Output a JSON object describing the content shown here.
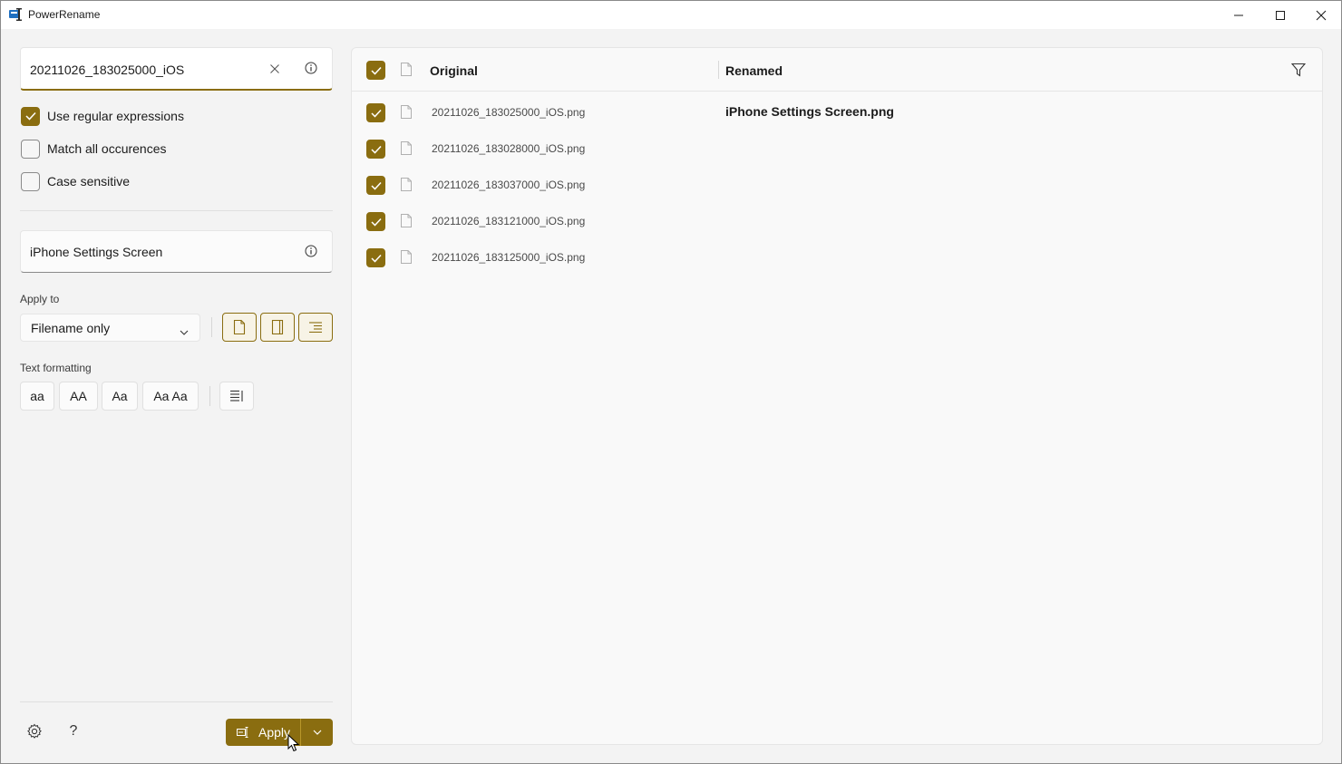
{
  "window": {
    "title": "PowerRename"
  },
  "search": {
    "value": "20211026_183025000_iOS"
  },
  "options": {
    "use_regex": {
      "label": "Use regular expressions",
      "checked": true
    },
    "match_all": {
      "label": "Match all occurences",
      "checked": false
    },
    "case_sensitive": {
      "label": "Case sensitive",
      "checked": false
    }
  },
  "replace": {
    "value": "iPhone Settings Screen"
  },
  "apply_to": {
    "label": "Apply to",
    "selected": "Filename only"
  },
  "text_formatting": {
    "label": "Text formatting",
    "buttons": [
      "aa",
      "AA",
      "Aa",
      "Aa Aa"
    ]
  },
  "footer": {
    "apply_label": "Apply"
  },
  "list": {
    "header": {
      "original": "Original",
      "renamed": "Renamed"
    },
    "rows": [
      {
        "original": "20211026_183025000_iOS.png",
        "renamed": "iPhone Settings Screen.png",
        "checked": true
      },
      {
        "original": "20211026_183028000_iOS.png",
        "renamed": "",
        "checked": true
      },
      {
        "original": "20211026_183037000_iOS.png",
        "renamed": "",
        "checked": true
      },
      {
        "original": "20211026_183121000_iOS.png",
        "renamed": "",
        "checked": true
      },
      {
        "original": "20211026_183125000_iOS.png",
        "renamed": "",
        "checked": true
      }
    ]
  },
  "colors": {
    "accent": "#8a6d10",
    "window_bg": "#f3f3f3"
  }
}
